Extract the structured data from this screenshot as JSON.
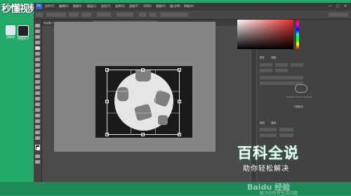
{
  "watermark": {
    "top_left": "秒懂视频"
  },
  "desktop": {
    "icons": [
      {
        "label": "回收站"
      },
      {
        "label": "快速学习"
      }
    ]
  },
  "app": {
    "logo": "Ps",
    "menu": [
      "文件(F)",
      "编辑(E)",
      "图像(I)",
      "图层(L)",
      "类型(Y)",
      "选择(S)",
      "滤镜(T)",
      "3D(D)",
      "视图(V)",
      "窗口(W)",
      "帮助(H)"
    ],
    "window_controls": [
      "—",
      "□",
      "✕"
    ]
  },
  "tabs": [
    {
      "label": "未标题-1 @ 66.7%"
    },
    {
      "label": "足球.jpg @ 33.3%(RGB/8)"
    }
  ],
  "panels": {
    "tabs_top": [
      "颜色",
      "色板"
    ],
    "tabs_mid": [
      "属性",
      "调整"
    ],
    "tabs_bottom": [
      "图层",
      "通道"
    ],
    "cloud_text": "Creative Cloud Libraries",
    "cloud_button": "了解更多"
  },
  "overlay": {
    "title": "百科全说",
    "subtitle": "助你轻松解决",
    "bottom_logo": "Baidu 经验",
    "bottom_sub": "解决你所有生活问题"
  },
  "colors": {
    "desktop": "#23a86a",
    "ps_bg": "#535353",
    "accent_red": "#e52b2b"
  }
}
